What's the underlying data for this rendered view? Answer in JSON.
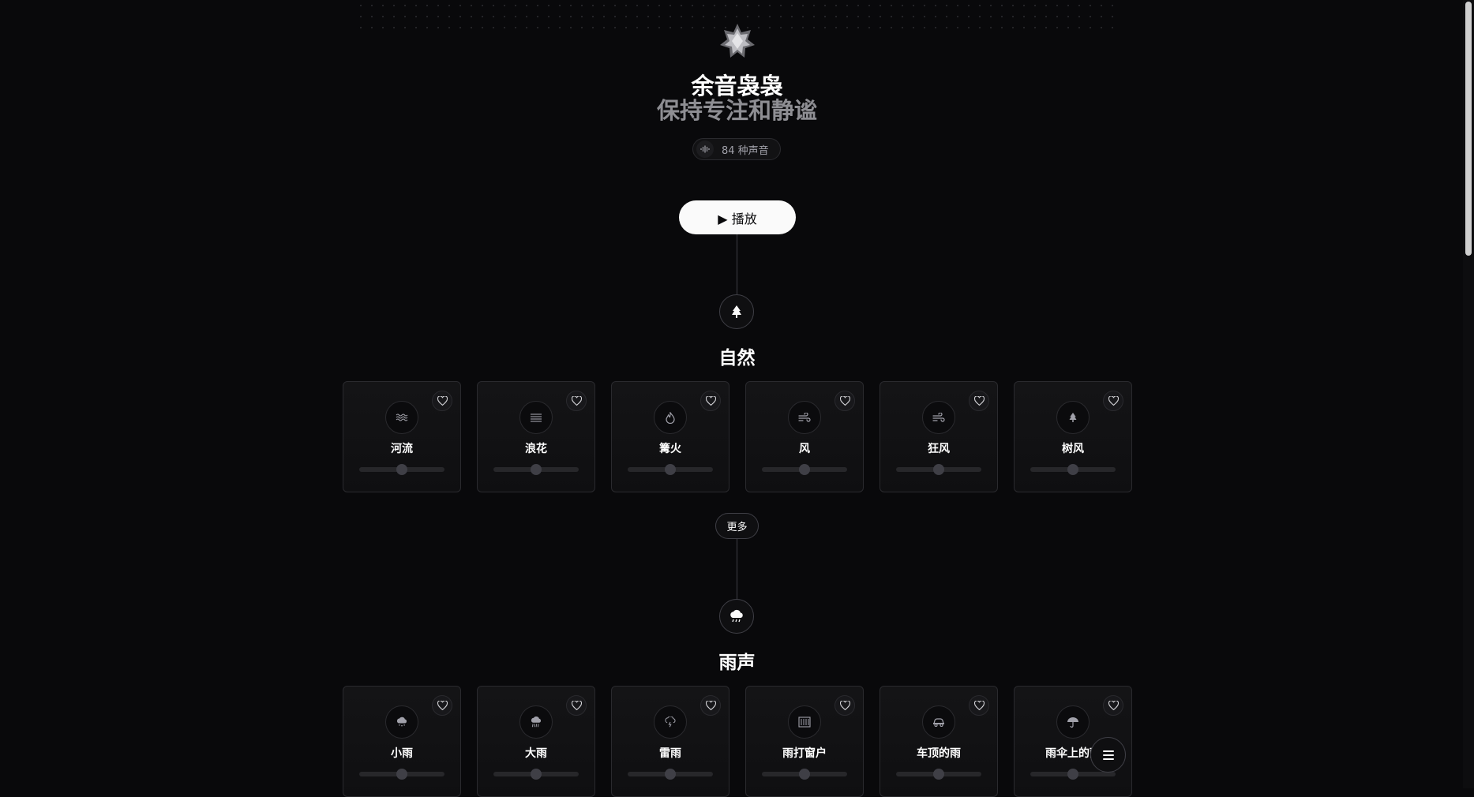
{
  "header": {
    "title": "余音袅袅",
    "subtitle": "保持专注和静谧",
    "sound_count": "84 种声音"
  },
  "controls": {
    "play_label": "▶ 播放",
    "more_label": "更多"
  },
  "sections": [
    {
      "title": "自然",
      "icon": "tree-icon",
      "sounds": [
        {
          "label": "河流",
          "icon": "waves-icon",
          "volume": 0.5
        },
        {
          "label": "浪花",
          "icon": "water-lines-icon",
          "volume": 0.5
        },
        {
          "label": "篝火",
          "icon": "flame-icon",
          "volume": 0.5
        },
        {
          "label": "风",
          "icon": "wind-icon",
          "volume": 0.5
        },
        {
          "label": "狂风",
          "icon": "wind-icon",
          "volume": 0.5
        },
        {
          "label": "树风",
          "icon": "tree-icon",
          "volume": 0.5
        }
      ]
    },
    {
      "title": "雨声",
      "icon": "cloud-rain-icon",
      "sounds": [
        {
          "label": "小雨",
          "icon": "cloud-drizzle-icon",
          "volume": 0.5
        },
        {
          "label": "大雨",
          "icon": "cloud-rain-icon",
          "volume": 0.5
        },
        {
          "label": "雷雨",
          "icon": "cloud-lightning-icon",
          "volume": 0.5
        },
        {
          "label": "雨打窗户",
          "icon": "window-rain-icon",
          "volume": 0.5
        },
        {
          "label": "车顶的雨",
          "icon": "car-icon",
          "volume": 0.5
        },
        {
          "label": "雨伞上的雨",
          "icon": "umbrella-icon",
          "volume": 0.5
        }
      ]
    }
  ],
  "colors": {
    "background": "#09090b",
    "card_border": "#2a2a2e",
    "accent": "#fafafa",
    "muted": "#8e8e93"
  }
}
